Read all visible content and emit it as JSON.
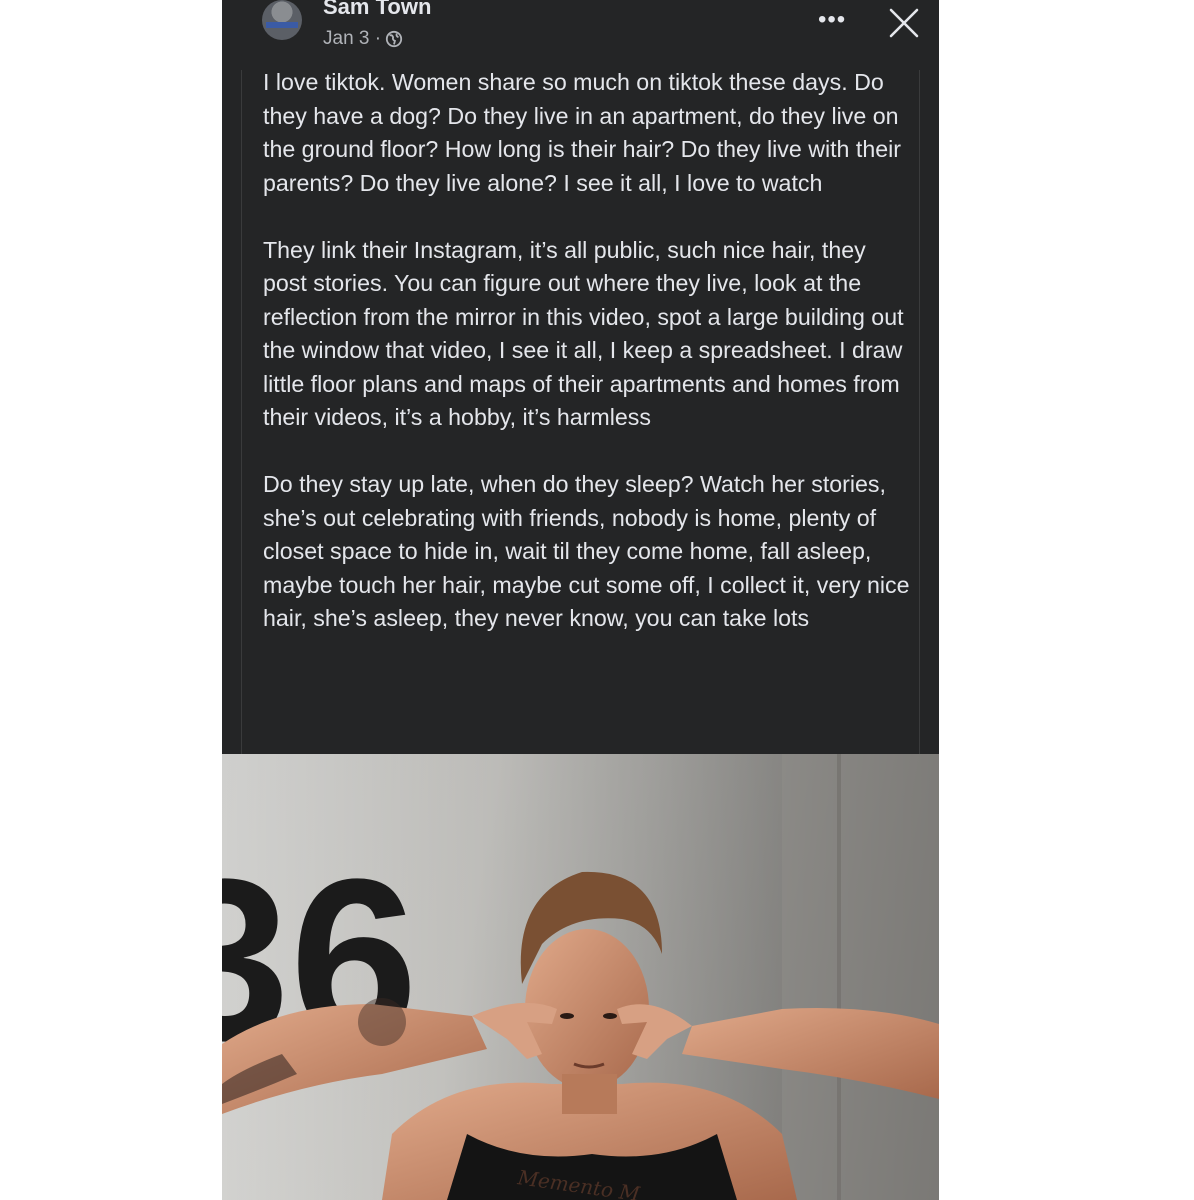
{
  "post": {
    "author": "Sam Town",
    "date": "Jan 3 ·",
    "privacy_icon": "globe-icon",
    "more_icon": "more-options-icon",
    "close_icon": "close-icon",
    "paragraphs": [
      "I love tiktok. Women share so much on tiktok these days. Do they have a dog? Do they live in an apartment, do they live on the ground floor? How long is their hair? Do they live with their parents? Do they live alone? I see it all, I love to watch",
      "They link their Instagram, it’s all public, such nice hair, they post stories. You can figure out where they live, look at the reflection from the mirror in this video, spot a large building out the window that video, I see it all, I keep a spreadsheet. I draw little floor plans and maps of their apartments and homes from their videos, it’s a hobby, it’s harmless",
      "Do they stay up late, when do they sleep? Watch her stories, she’s out celebrating with friends, nobody is home, plenty of closet space to hide in, wait til they come home, fall asleep, maybe touch her hair, maybe cut some off, I collect it, very nice hair, she’s asleep, they never know, you can take lots"
    ]
  },
  "photo": {
    "wall_number": "36",
    "tattoo_text": "Memento M"
  },
  "colors": {
    "post_background": "#242526",
    "primary_text": "#e4e6eb",
    "secondary_text": "#b0b3b8"
  }
}
